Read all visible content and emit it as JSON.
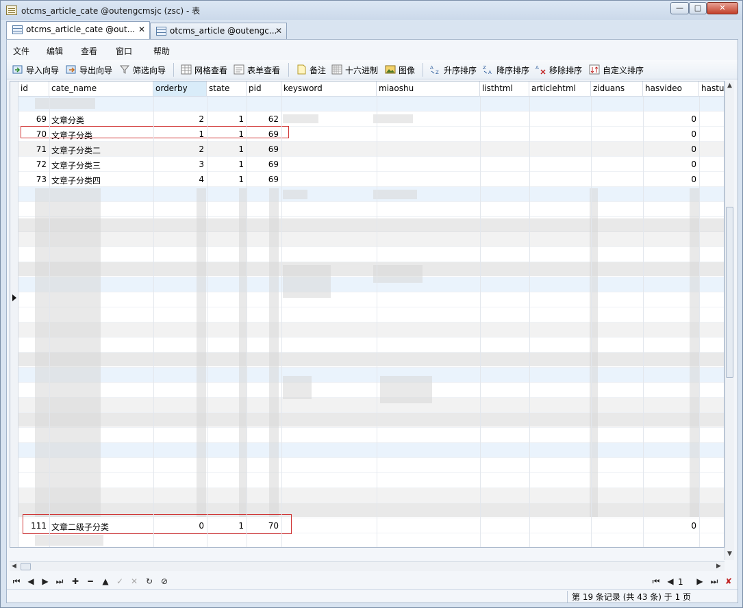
{
  "window": {
    "title": "otcms_article_cate @outengcmsjc (zsc) - 表",
    "min": "—",
    "max": "□",
    "close": "✕"
  },
  "tabs": [
    {
      "label": "otcms_article_cate @out...",
      "close": "✕"
    },
    {
      "label": "otcms_article @outengc...",
      "close": "✕"
    }
  ],
  "menu": [
    "文件",
    "编辑",
    "查看",
    "窗口",
    "帮助"
  ],
  "toolbar": {
    "import": "导入向导",
    "export": "导出向导",
    "filter": "筛选向导",
    "grid_view": "网格查看",
    "form_view": "表单查看",
    "memo": "备注",
    "hex": "十六进制",
    "image": "图像",
    "sort_asc": "升序排序",
    "sort_desc": "降序排序",
    "remove_sort": "移除排序",
    "custom_sort": "自定义排序"
  },
  "columns": [
    "id",
    "cate_name",
    "orderby",
    "state",
    "pid",
    "keysword",
    "miaoshu",
    "listhtml",
    "articlehtml",
    "ziduans",
    "hasvideo",
    "hastuj"
  ],
  "rows": [
    {
      "id": "69",
      "cate_name": "文章分类",
      "orderby": "2",
      "state": "1",
      "pid": "62",
      "hasvideo": "0"
    },
    {
      "id": "70",
      "cate_name": "文章子分类",
      "orderby": "1",
      "state": "1",
      "pid": "69",
      "hasvideo": "0"
    },
    {
      "id": "71",
      "cate_name": "文章子分类二",
      "orderby": "2",
      "state": "1",
      "pid": "69",
      "hasvideo": "0"
    },
    {
      "id": "72",
      "cate_name": "文章子分类三",
      "orderby": "3",
      "state": "1",
      "pid": "69",
      "hasvideo": "0"
    },
    {
      "id": "73",
      "cate_name": "文章子分类四",
      "orderby": "4",
      "state": "1",
      "pid": "69",
      "hasvideo": "0"
    },
    {
      "id": "111",
      "cate_name": "文章二级子分类",
      "orderby": "0",
      "state": "1",
      "pid": "70",
      "hasvideo": "0"
    }
  ],
  "navigation": {
    "page_input": "1"
  },
  "status": "第 19 条记录 (共 43 条) 于 1 页"
}
